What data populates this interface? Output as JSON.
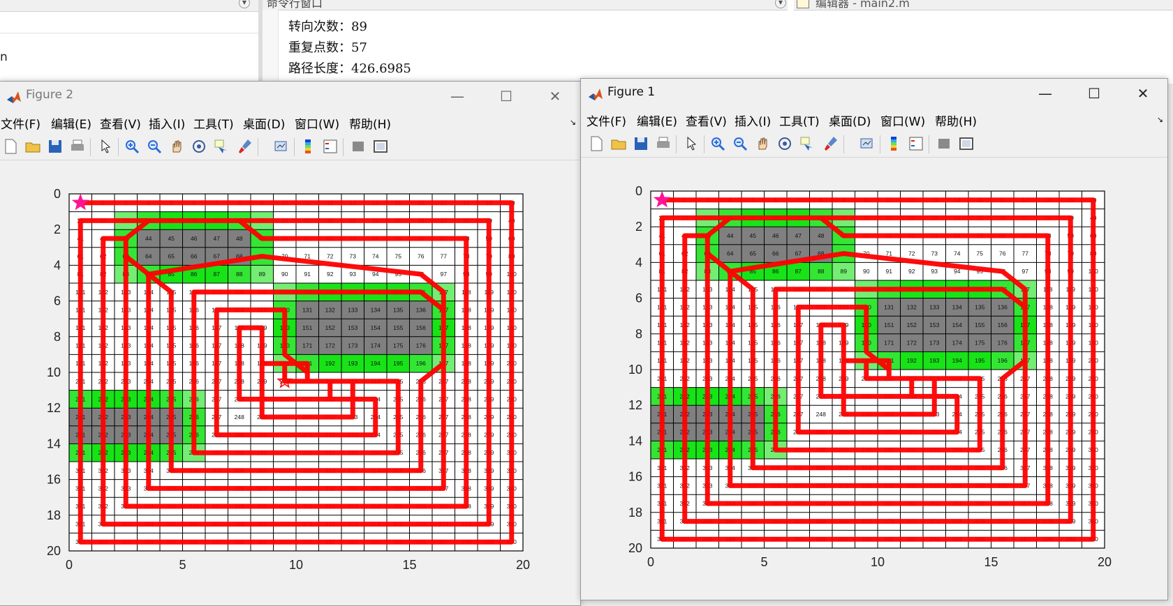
{
  "background": {
    "left_text": "n",
    "command_window": {
      "title": "命令行窗口",
      "lines": [
        "转向次数：89",
        "重复点数：57",
        "路径长度：426.6985"
      ]
    },
    "editor_tab": {
      "title": "编辑器 - main2.m"
    }
  },
  "figures": [
    {
      "id": "fig2",
      "title": "Figure 2",
      "close": "✕",
      "maximize": "☐",
      "minimize": "—"
    },
    {
      "id": "fig1",
      "title": "Figure 1",
      "close": "✕",
      "maximize": "☐",
      "minimize": "—"
    }
  ],
  "menu": [
    "文件(F)",
    "编辑(E)",
    "查看(V)",
    "插入(I)",
    "工具(T)",
    "桌面(D)",
    "窗口(W)",
    "帮助(H)"
  ],
  "toolbar_icons": [
    "new-file-icon",
    "open-folder-icon",
    "save-icon",
    "print-icon",
    "pointer-icon",
    "zoom-in-icon",
    "zoom-out-icon",
    "pan-icon",
    "rotate-3d-icon",
    "data-cursor-icon",
    "brush-icon",
    "link-plot-icon",
    "colorbar-icon",
    "legend-icon",
    "hide-tools-icon",
    "dock-icon"
  ],
  "colors": {
    "path": "#ff0000",
    "obstacle": "#808080",
    "inflation": "#00e000",
    "start": "#ff1493",
    "grid": "#000000"
  },
  "chart_data": [
    {
      "type": "grid-map",
      "figure": "Figure 2",
      "xticks": [
        "0",
        "5",
        "10",
        "15",
        "20"
      ],
      "yticks": [
        "0",
        "2",
        "4",
        "6",
        "8",
        "10",
        "12",
        "14",
        "16",
        "18",
        "20"
      ],
      "xlim": [
        0,
        20
      ],
      "ylim": [
        0,
        20
      ],
      "y_reversed": true,
      "grid_size": 20,
      "cell_numbering": "row-major 1..400",
      "obstacles": [
        44,
        45,
        46,
        47,
        48,
        64,
        65,
        66,
        67,
        68,
        131,
        132,
        133,
        134,
        135,
        136,
        151,
        152,
        153,
        154,
        155,
        156,
        171,
        172,
        173,
        174,
        175,
        176,
        241,
        242,
        243,
        244,
        245,
        261,
        262,
        263,
        264,
        265
      ],
      "start": [
        0.5,
        0.5
      ],
      "end_marker": [
        9.5,
        10.5
      ],
      "path_style": "inward spiral coverage path"
    },
    {
      "type": "grid-map",
      "figure": "Figure 1",
      "xticks": [
        "0",
        "5",
        "10",
        "15",
        "20"
      ],
      "yticks": [
        "0",
        "2",
        "4",
        "6",
        "8",
        "10",
        "12",
        "14",
        "16",
        "18",
        "20"
      ],
      "xlim": [
        0,
        20
      ],
      "ylim": [
        0,
        20
      ],
      "y_reversed": true,
      "grid_size": 20,
      "cell_numbering": "row-major 1..400",
      "obstacles": [
        44,
        45,
        46,
        47,
        48,
        64,
        65,
        66,
        67,
        68,
        131,
        132,
        133,
        134,
        135,
        136,
        151,
        152,
        153,
        154,
        155,
        156,
        171,
        172,
        173,
        174,
        175,
        176,
        241,
        242,
        243,
        244,
        245,
        261,
        262,
        263,
        264,
        265
      ],
      "start": [
        0.5,
        0.5
      ],
      "path_style": "inward spiral coverage path"
    }
  ]
}
